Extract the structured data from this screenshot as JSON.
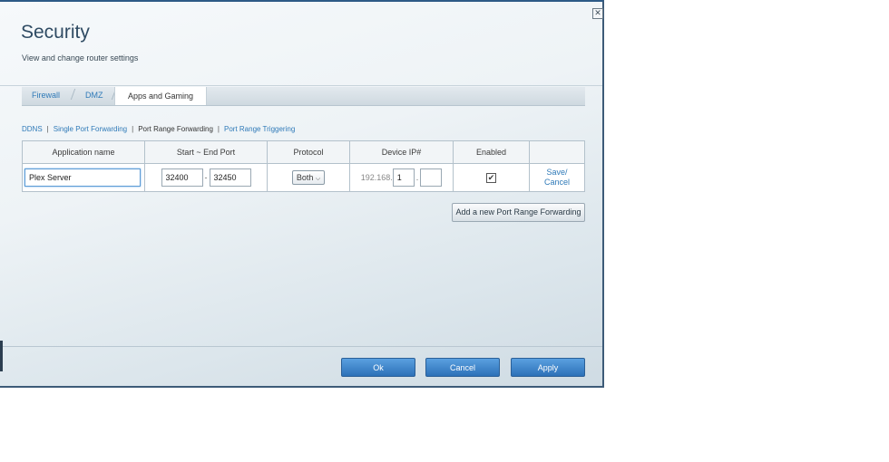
{
  "window": {
    "close_glyph": "✕"
  },
  "header": {
    "title": "Security",
    "subtitle": "View and change router settings"
  },
  "tabs": [
    {
      "label": "Firewall",
      "active": false
    },
    {
      "label": "DMZ",
      "active": false
    },
    {
      "label": "Apps and Gaming",
      "active": true
    }
  ],
  "subnav": [
    {
      "label": "DDNS",
      "current": false
    },
    {
      "label": "Single Port Forwarding",
      "current": false
    },
    {
      "label": "Port Range Forwarding",
      "current": true
    },
    {
      "label": "Port Range Triggering",
      "current": false
    }
  ],
  "table": {
    "headers": [
      "Application name",
      "Start ~ End Port",
      "Protocol",
      "Device IP#",
      "Enabled",
      ""
    ],
    "row": {
      "app_name": "Plex Server",
      "start_port": "32400",
      "port_separator": "-",
      "end_port": "32450",
      "protocol": "Both",
      "ip_prefix": "192.168.",
      "ip_third": "1",
      "ip_separator": ".",
      "ip_fourth": "",
      "enabled": true,
      "enabled_glyph": "✔",
      "save_label": "Save/",
      "cancel_label": "Cancel"
    }
  },
  "add_button": "Add a new Port Range Forwarding",
  "footer": {
    "ok": "Ok",
    "cancel": "Cancel",
    "apply": "Apply"
  },
  "colors": {
    "accent": "#2f7ab8",
    "button": "#3a84cc",
    "title": "#2f4b63"
  }
}
